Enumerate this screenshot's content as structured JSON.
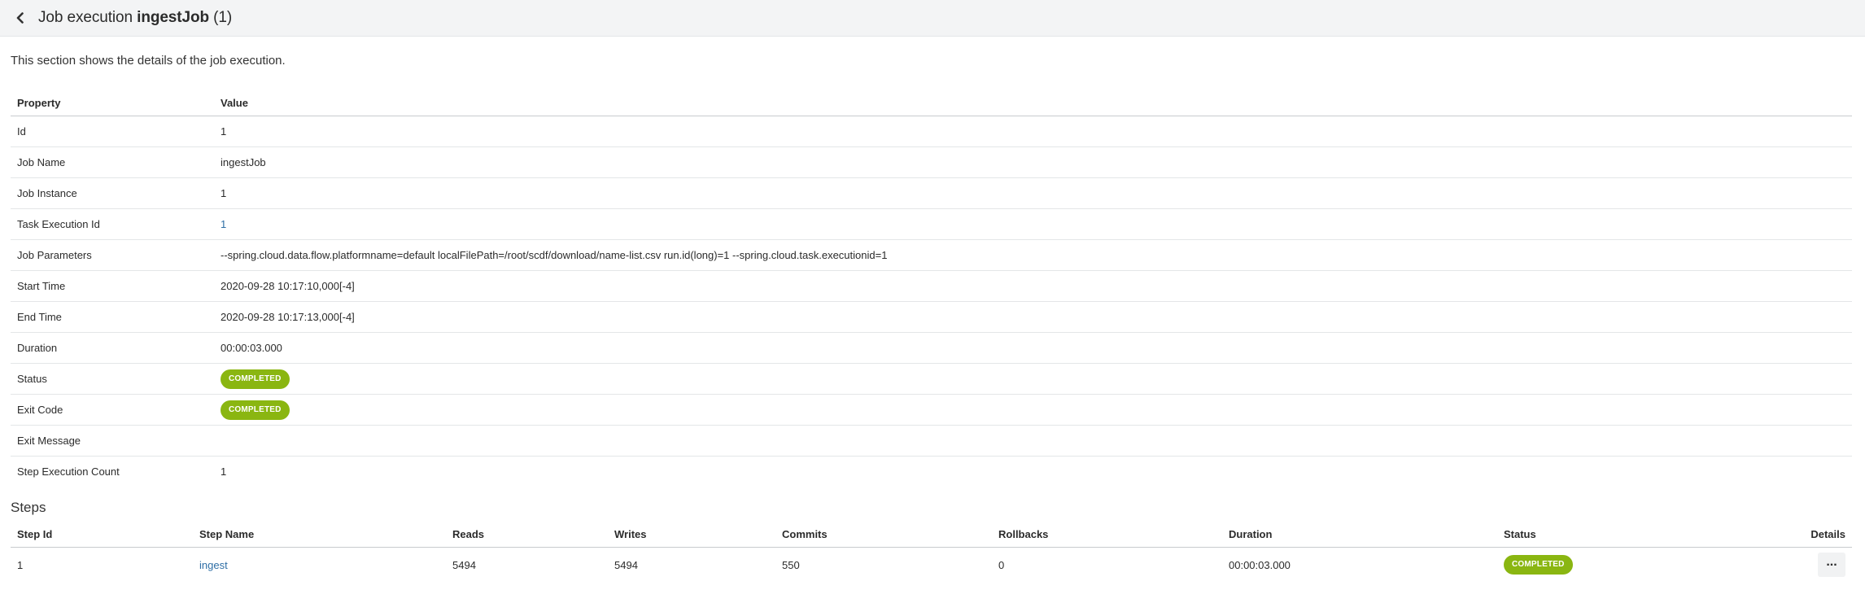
{
  "header": {
    "title_prefix": "Job execution",
    "job_name": "ingestJob",
    "job_count": "(1)"
  },
  "description": "This section shows the details of the job execution.",
  "properties": {
    "header_property": "Property",
    "header_value": "Value",
    "rows": [
      {
        "key": "Id",
        "value": "1"
      },
      {
        "key": "Job Name",
        "value": "ingestJob"
      },
      {
        "key": "Job Instance",
        "value": "1"
      },
      {
        "key": "Task Execution Id",
        "value": "1",
        "link": true
      },
      {
        "key": "Job Parameters",
        "value": "--spring.cloud.data.flow.platformname=default localFilePath=/root/scdf/download/name-list.csv run.id(long)=1 --spring.cloud.task.executionid=1"
      },
      {
        "key": "Start Time",
        "value": "2020-09-28 10:17:10,000[-4]"
      },
      {
        "key": "End Time",
        "value": "2020-09-28 10:17:13,000[-4]"
      },
      {
        "key": "Duration",
        "value": "00:00:03.000"
      },
      {
        "key": "Status",
        "value": "COMPLETED",
        "badge": true
      },
      {
        "key": "Exit Code",
        "value": "COMPLETED",
        "badge": true
      },
      {
        "key": "Exit Message",
        "value": ""
      },
      {
        "key": "Step Execution Count",
        "value": "1"
      }
    ]
  },
  "steps": {
    "title": "Steps",
    "columns": [
      "Step Id",
      "Step Name",
      "Reads",
      "Writes",
      "Commits",
      "Rollbacks",
      "Duration",
      "Status",
      "Details"
    ],
    "rows": [
      {
        "step_id": "1",
        "step_name": "ingest",
        "reads": "5494",
        "writes": "5494",
        "commits": "550",
        "rollbacks": "0",
        "duration": "00:00:03.000",
        "status": "COMPLETED",
        "details": "..."
      }
    ]
  },
  "colors": {
    "accent_link": "#2f6fa6",
    "badge_success": "#8ab611",
    "header_bg": "#f3f4f5"
  },
  "icons": {
    "back": "chevron-left-icon"
  }
}
